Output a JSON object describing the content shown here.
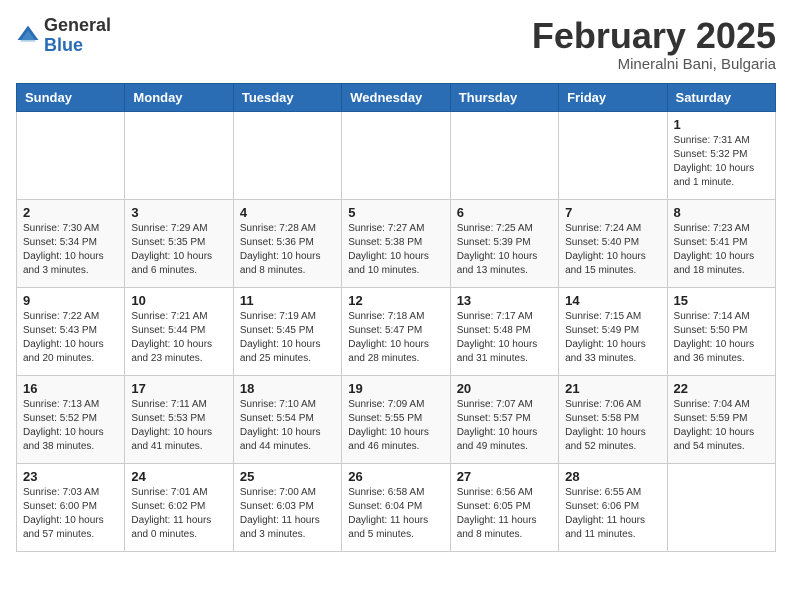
{
  "header": {
    "logo_general": "General",
    "logo_blue": "Blue",
    "month_title": "February 2025",
    "location": "Mineralni Bani, Bulgaria"
  },
  "weekdays": [
    "Sunday",
    "Monday",
    "Tuesday",
    "Wednesday",
    "Thursday",
    "Friday",
    "Saturday"
  ],
  "weeks": [
    [
      {
        "day": "",
        "info": ""
      },
      {
        "day": "",
        "info": ""
      },
      {
        "day": "",
        "info": ""
      },
      {
        "day": "",
        "info": ""
      },
      {
        "day": "",
        "info": ""
      },
      {
        "day": "",
        "info": ""
      },
      {
        "day": "1",
        "info": "Sunrise: 7:31 AM\nSunset: 5:32 PM\nDaylight: 10 hours\nand 1 minute."
      }
    ],
    [
      {
        "day": "2",
        "info": "Sunrise: 7:30 AM\nSunset: 5:34 PM\nDaylight: 10 hours\nand 3 minutes."
      },
      {
        "day": "3",
        "info": "Sunrise: 7:29 AM\nSunset: 5:35 PM\nDaylight: 10 hours\nand 6 minutes."
      },
      {
        "day": "4",
        "info": "Sunrise: 7:28 AM\nSunset: 5:36 PM\nDaylight: 10 hours\nand 8 minutes."
      },
      {
        "day": "5",
        "info": "Sunrise: 7:27 AM\nSunset: 5:38 PM\nDaylight: 10 hours\nand 10 minutes."
      },
      {
        "day": "6",
        "info": "Sunrise: 7:25 AM\nSunset: 5:39 PM\nDaylight: 10 hours\nand 13 minutes."
      },
      {
        "day": "7",
        "info": "Sunrise: 7:24 AM\nSunset: 5:40 PM\nDaylight: 10 hours\nand 15 minutes."
      },
      {
        "day": "8",
        "info": "Sunrise: 7:23 AM\nSunset: 5:41 PM\nDaylight: 10 hours\nand 18 minutes."
      }
    ],
    [
      {
        "day": "9",
        "info": "Sunrise: 7:22 AM\nSunset: 5:43 PM\nDaylight: 10 hours\nand 20 minutes."
      },
      {
        "day": "10",
        "info": "Sunrise: 7:21 AM\nSunset: 5:44 PM\nDaylight: 10 hours\nand 23 minutes."
      },
      {
        "day": "11",
        "info": "Sunrise: 7:19 AM\nSunset: 5:45 PM\nDaylight: 10 hours\nand 25 minutes."
      },
      {
        "day": "12",
        "info": "Sunrise: 7:18 AM\nSunset: 5:47 PM\nDaylight: 10 hours\nand 28 minutes."
      },
      {
        "day": "13",
        "info": "Sunrise: 7:17 AM\nSunset: 5:48 PM\nDaylight: 10 hours\nand 31 minutes."
      },
      {
        "day": "14",
        "info": "Sunrise: 7:15 AM\nSunset: 5:49 PM\nDaylight: 10 hours\nand 33 minutes."
      },
      {
        "day": "15",
        "info": "Sunrise: 7:14 AM\nSunset: 5:50 PM\nDaylight: 10 hours\nand 36 minutes."
      }
    ],
    [
      {
        "day": "16",
        "info": "Sunrise: 7:13 AM\nSunset: 5:52 PM\nDaylight: 10 hours\nand 38 minutes."
      },
      {
        "day": "17",
        "info": "Sunrise: 7:11 AM\nSunset: 5:53 PM\nDaylight: 10 hours\nand 41 minutes."
      },
      {
        "day": "18",
        "info": "Sunrise: 7:10 AM\nSunset: 5:54 PM\nDaylight: 10 hours\nand 44 minutes."
      },
      {
        "day": "19",
        "info": "Sunrise: 7:09 AM\nSunset: 5:55 PM\nDaylight: 10 hours\nand 46 minutes."
      },
      {
        "day": "20",
        "info": "Sunrise: 7:07 AM\nSunset: 5:57 PM\nDaylight: 10 hours\nand 49 minutes."
      },
      {
        "day": "21",
        "info": "Sunrise: 7:06 AM\nSunset: 5:58 PM\nDaylight: 10 hours\nand 52 minutes."
      },
      {
        "day": "22",
        "info": "Sunrise: 7:04 AM\nSunset: 5:59 PM\nDaylight: 10 hours\nand 54 minutes."
      }
    ],
    [
      {
        "day": "23",
        "info": "Sunrise: 7:03 AM\nSunset: 6:00 PM\nDaylight: 10 hours\nand 57 minutes."
      },
      {
        "day": "24",
        "info": "Sunrise: 7:01 AM\nSunset: 6:02 PM\nDaylight: 11 hours\nand 0 minutes."
      },
      {
        "day": "25",
        "info": "Sunrise: 7:00 AM\nSunset: 6:03 PM\nDaylight: 11 hours\nand 3 minutes."
      },
      {
        "day": "26",
        "info": "Sunrise: 6:58 AM\nSunset: 6:04 PM\nDaylight: 11 hours\nand 5 minutes."
      },
      {
        "day": "27",
        "info": "Sunrise: 6:56 AM\nSunset: 6:05 PM\nDaylight: 11 hours\nand 8 minutes."
      },
      {
        "day": "28",
        "info": "Sunrise: 6:55 AM\nSunset: 6:06 PM\nDaylight: 11 hours\nand 11 minutes."
      },
      {
        "day": "",
        "info": ""
      }
    ]
  ]
}
